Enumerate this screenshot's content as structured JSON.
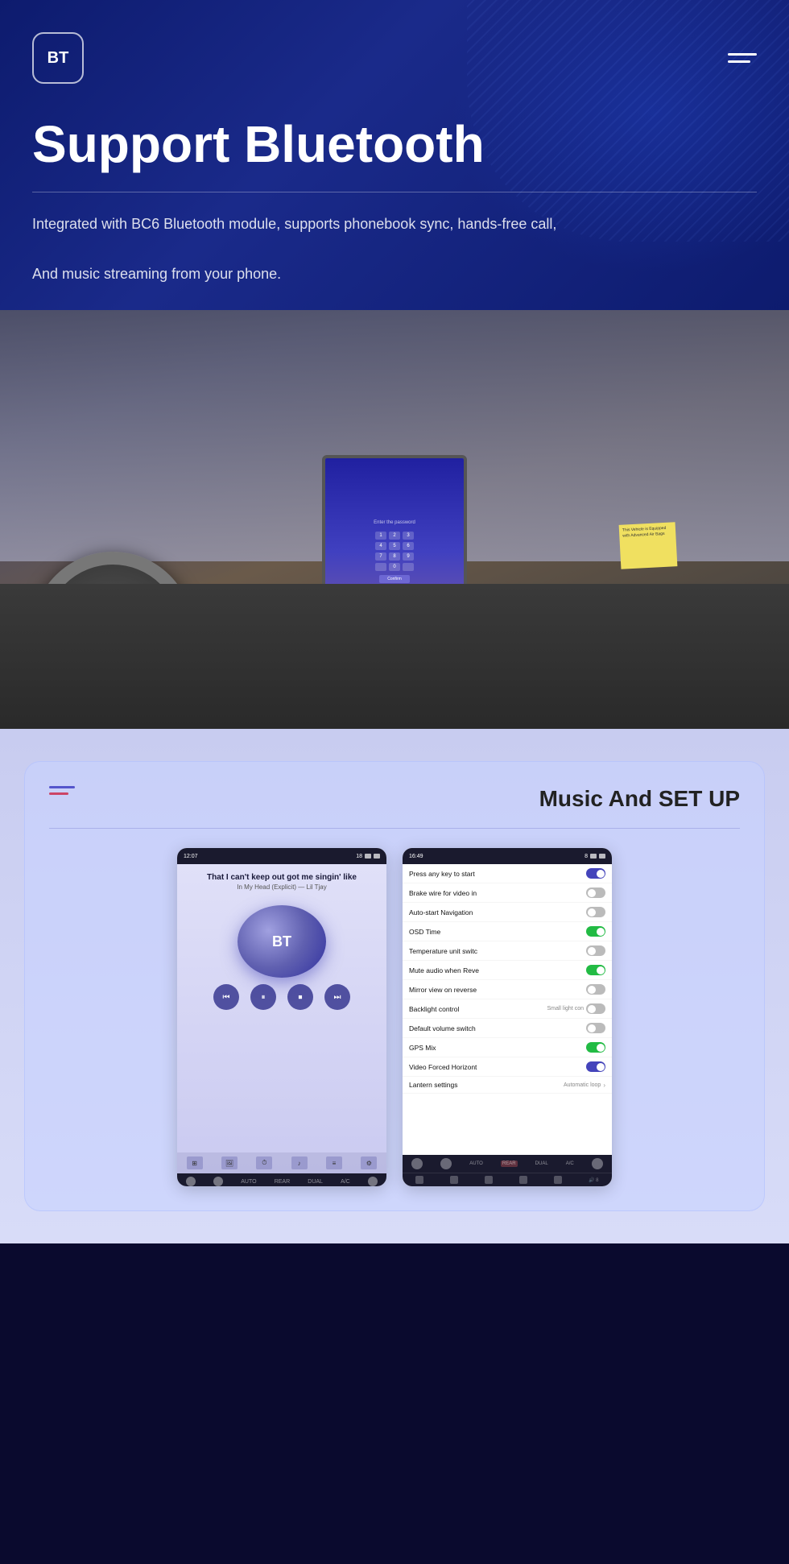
{
  "nav": {
    "logo_text": "BT",
    "menu_label": "Menu"
  },
  "hero": {
    "title": "Support Bluetooth",
    "divider": true,
    "description_line1": "Integrated with BC6 Bluetooth module, supports phonebook sync, hands-free call,",
    "description_line2": "And music streaming from your phone."
  },
  "car_screen": {
    "prompt": "Enter the password",
    "numpad": [
      "1",
      "2",
      "3",
      "4",
      "5",
      "6",
      "7",
      "8",
      "9",
      "0"
    ],
    "confirm_label": "Confirm"
  },
  "music_setup": {
    "header_title": "Music And SET UP",
    "divider": true
  },
  "music_player": {
    "song_title": "That I can't keep out got me singin' like",
    "song_sub": "In My Head (Explicit) — Lil Tjay",
    "disc_label": "BT",
    "controls": [
      "⏮",
      "⏭",
      "⏹",
      "⏭"
    ]
  },
  "settings_screen": {
    "items": [
      {
        "label": "Press any key to start",
        "state": "on",
        "extra": ""
      },
      {
        "label": "Brake wire for video in",
        "state": "off",
        "extra": ""
      },
      {
        "label": "Auto-start Navigation",
        "state": "off",
        "extra": ""
      },
      {
        "label": "OSD Time",
        "state": "green",
        "extra": ""
      },
      {
        "label": "Temperature unit switc",
        "state": "off",
        "extra": ""
      },
      {
        "label": "Mute audio when Reve",
        "state": "green",
        "extra": ""
      },
      {
        "label": "Mirror view on reverse",
        "state": "off",
        "extra": ""
      },
      {
        "label": "Backlight control",
        "state": "off",
        "extra": "Small light con"
      },
      {
        "label": "Default volume switch",
        "state": "off",
        "extra": ""
      },
      {
        "label": "GPS Mix",
        "state": "green",
        "extra": ""
      },
      {
        "label": "Video Forced Horizont",
        "state": "on",
        "extra": ""
      },
      {
        "label": "Lantern settings",
        "state": "chevron",
        "extra": "Automatic loop"
      }
    ]
  }
}
